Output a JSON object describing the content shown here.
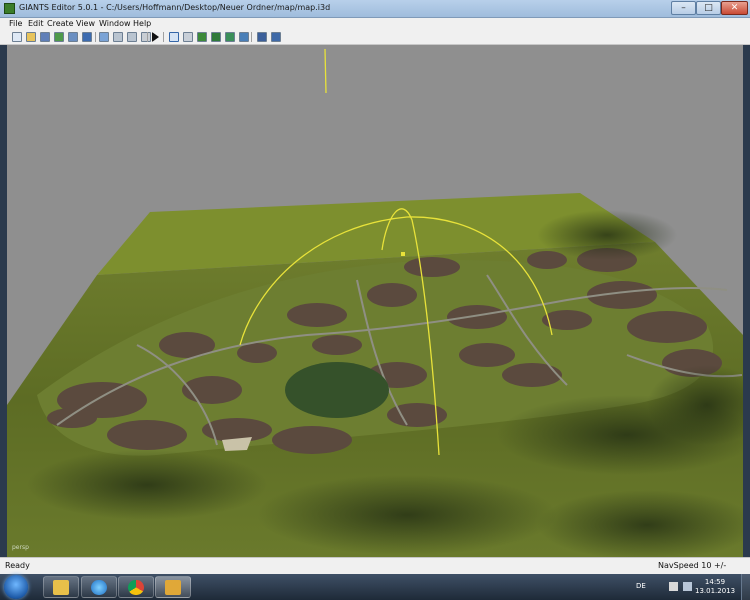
{
  "window": {
    "title": "GIANTS Editor 5.0.1 - C:/Users/Hoffmann/Desktop/Neuer Ordner/map/map.i3d",
    "app_icon": "giants-editor-icon",
    "min_glyph": "–",
    "max_glyph": "□",
    "close_glyph": "✕"
  },
  "menubar": {
    "items": [
      "File",
      "Edit",
      "Create",
      "View",
      "Window",
      "Help"
    ]
  },
  "toolbar": {
    "buttons": [
      "new-icon",
      "open-icon",
      "save-icon",
      "save-as-icon",
      "export-icon",
      "import-icon",
      "properties-icon",
      "undo-icon",
      "redo-icon",
      "clear-icon",
      "play-icon",
      "select-icon",
      "move-icon",
      "terrain-raise-icon",
      "terrain-smooth-icon",
      "terrain-paint-icon",
      "terrain-foliage-icon",
      "terrain-flatten-icon",
      "navmesh-icon",
      "measure-icon"
    ]
  },
  "viewport": {
    "camera_label": "persp",
    "sky_color": "#8f8f8f",
    "terrain_color": "#6b7a2c"
  },
  "statusbar": {
    "left": "Ready",
    "right": "NavSpeed 10 +/-"
  },
  "taskbar": {
    "items": [
      "explorer-icon",
      "internet-explorer-icon",
      "chrome-icon",
      "giants-editor-icon"
    ],
    "language": "DE",
    "time": "14:59",
    "date": "13.01.2013"
  }
}
